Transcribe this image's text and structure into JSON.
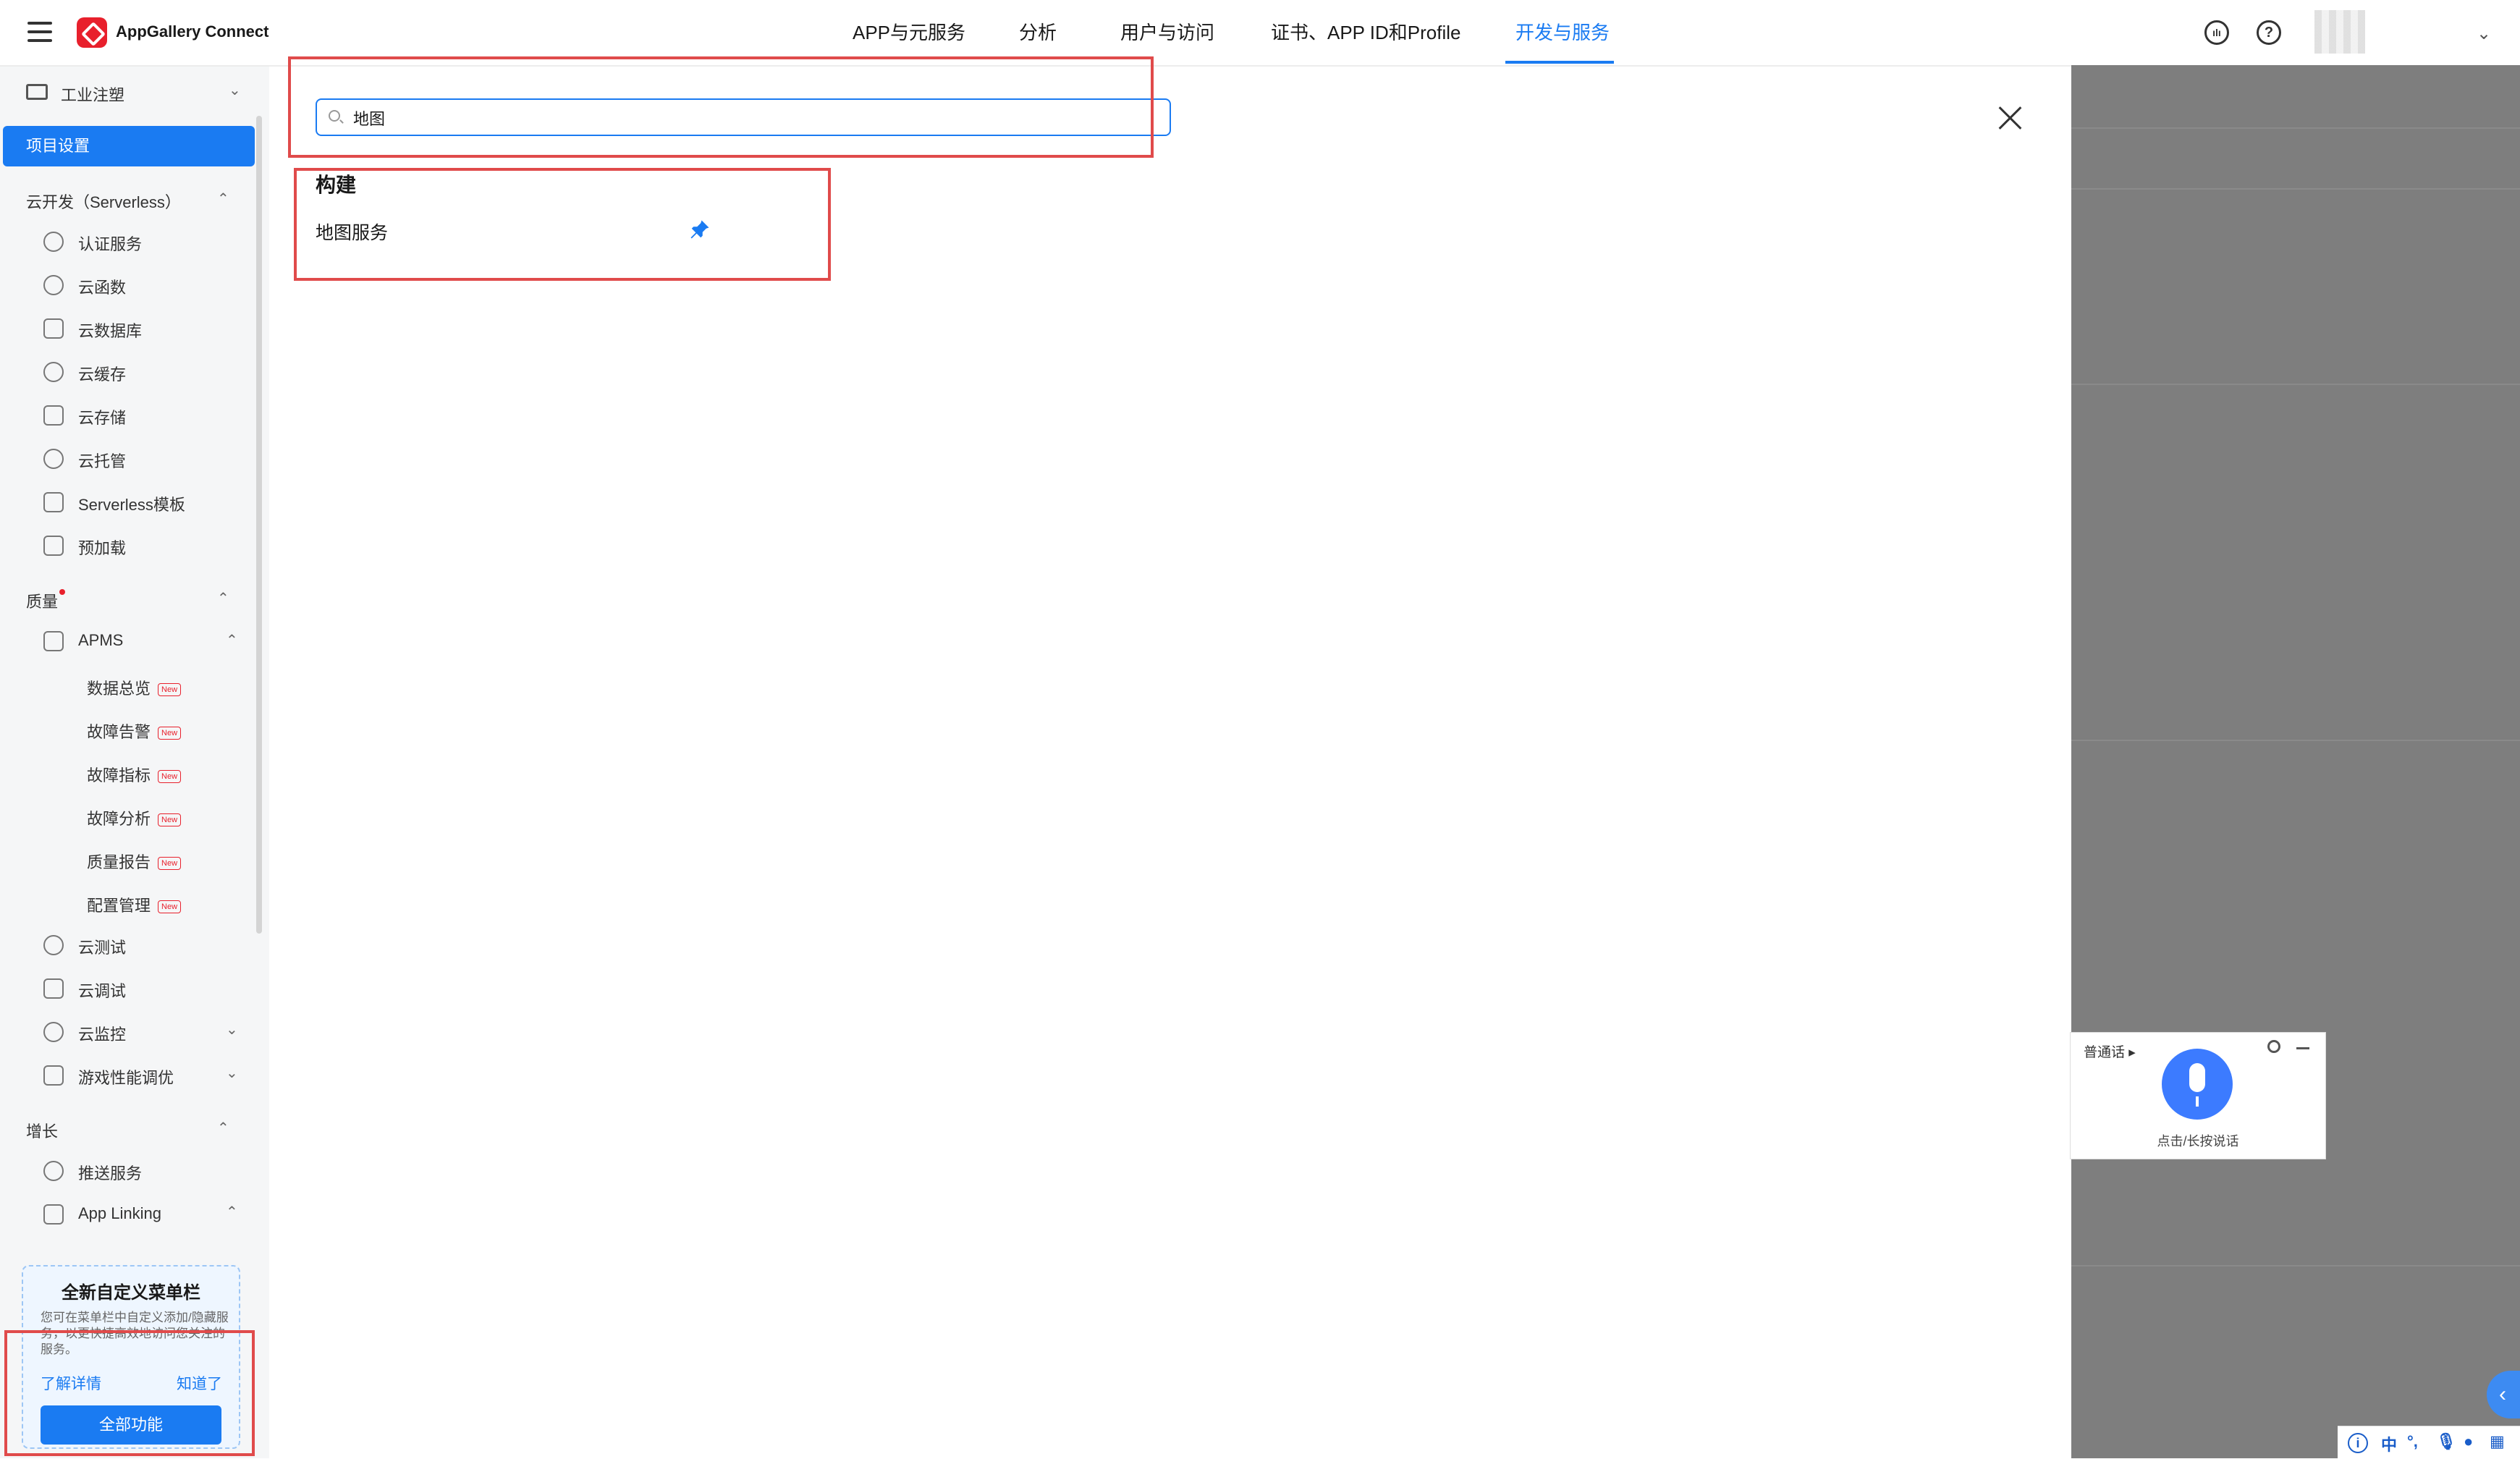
{
  "brand": "AppGallery Connect",
  "nav": {
    "tabs": [
      {
        "label": "APP与元服务"
      },
      {
        "label": "分析"
      },
      {
        "label": "用户与访问"
      },
      {
        "label": "证书、APP ID和Profile"
      },
      {
        "label": "开发与服务",
        "active": true
      }
    ],
    "accent_color": "#1a7bf2"
  },
  "sidebar": {
    "project_name": "工业注塑",
    "active_item": "项目设置",
    "groups": {
      "serverless": {
        "title": "云开发（Serverless）",
        "items": [
          "认证服务",
          "云函数",
          "云数据库",
          "云缓存",
          "云存储",
          "云托管",
          "Serverless模板",
          "预加载"
        ]
      },
      "quality": {
        "title": "质量",
        "apms": "APMS",
        "apms_items": [
          "数据总览",
          "故障告警",
          "故障指标",
          "故障分析",
          "质量报告",
          "配置管理"
        ],
        "new_badge": "New",
        "other_items": [
          "云测试",
          "云调试",
          "云监控",
          "游戏性能调优"
        ]
      },
      "growth": {
        "title": "增长",
        "items": [
          "推送服务",
          "App Linking"
        ]
      }
    },
    "promo": {
      "title": "全新自定义菜单栏",
      "text": "您可在菜单栏中自定义添加/隐藏服务，以更快捷高效地访问您关注的服务。",
      "learn_more": "了解详情",
      "got_it": "知道了",
      "button": "全部功能"
    }
  },
  "search": {
    "value": "地图",
    "result_group": "构建",
    "result_item": "地图服务"
  },
  "voice": {
    "language": "普通话",
    "hint": "点击/长按说话"
  },
  "ime": {
    "mode": "中",
    "punct": "°,"
  }
}
